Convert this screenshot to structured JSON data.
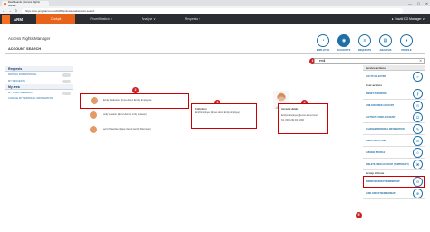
{
  "browser": {
    "tab_title": "Dashboards | Access Rights Mana...",
    "url": "https://ace-pmgr.demo.local/ARMprofessional/account-search",
    "controls": [
      "—",
      "☐",
      "✕"
    ]
  },
  "app": {
    "name": "ARM",
    "nav": [
      "Cockpit",
      "Recertification ∨",
      "Analyze ∨",
      "Requests ∨"
    ],
    "user": "David DO Manager ∨"
  },
  "page": {
    "title": "Access Rights Manager",
    "section": "ACCOUNT SEARCH"
  },
  "tabs": [
    {
      "label": "EMPLOYEE",
      "icon": "◔"
    },
    {
      "label": "ACCOUNTS",
      "icon": "◉"
    },
    {
      "label": "REQUESTS",
      "icon": "≡"
    },
    {
      "label": "ANALYSIS",
      "icon": "▤"
    },
    {
      "label": "PROFILE",
      "icon": "◑"
    }
  ],
  "search": {
    "value": "emil",
    "clear": "✕"
  },
  "left_sidebar": {
    "requests_header": "Requests",
    "requests_items": [
      "WAITING FOR APPROVAL",
      "MY REQUESTS",
      "MY STAFF MEMBERS",
      "CHANGE MY PERSONAL INFORMATION"
    ],
    "area_header": "My area"
  },
  "results": [
    {
      "name": "Emily Anderson (Emer-demo Emily Employee)"
    },
    {
      "name": "Emily Lawson (Emer-demo Emily Lawson)"
    },
    {
      "name": "Gerrit Peterdan (Emer-demo Gerrit Peterman)"
    }
  ],
  "collection": {
    "heading": "Collection",
    "value": "Emily Employee (Emer-demo Emily Employee)"
  },
  "account_details": {
    "heading": "Account details",
    "email": "Emily.E.Employee@emer-demo.local",
    "phone": "Tel. 0049 262 400 1006"
  },
  "right_sidebar": {
    "service_header": "Service actions",
    "service_items": [
      "GO TO SELECTION",
      "RESET PASSWORD",
      "UNLOCK USER ACCOUNT",
      "ACTIVATE USER ACCOUNT",
      "CHANGE PERSONAL INFORMATION",
      "DEACTIVATE USER",
      "ASSIGN PROFILE",
      "DELETE USER ACCOUNT (TEMPORARY)"
    ],
    "user_actions_header": "User actions",
    "group_header": "Group actions",
    "group_items": [
      "REMOVE GROUP MEMBERSHIP",
      "ADD GROUP MEMBERSHIP"
    ]
  },
  "markers": [
    "1",
    "2",
    "3",
    "4",
    "5"
  ],
  "colors": {
    "accent": "#e8631a",
    "header_bg": "#2b2d33",
    "link": "#1d6fa5",
    "highlight": "#c00"
  }
}
